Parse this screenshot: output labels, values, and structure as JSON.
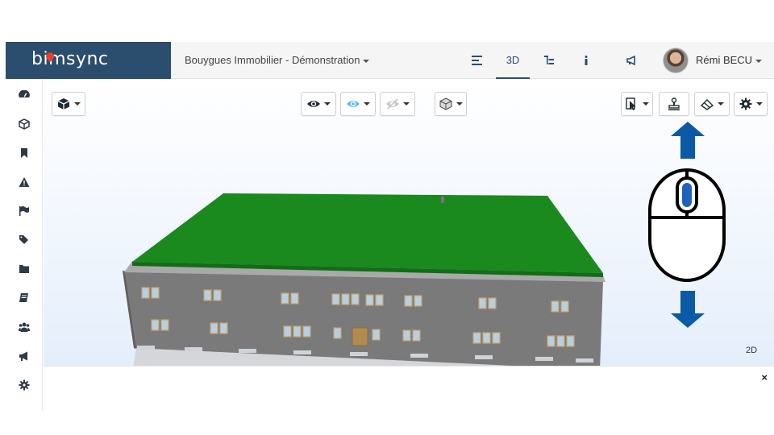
{
  "brand": {
    "logo_text": "bimsync",
    "color": "#2b4d6e",
    "accent": "#e8402f"
  },
  "header": {
    "project_name": "Bouygues Immobilier - Démonstration",
    "nav": [
      {
        "name": "list-icon",
        "label": ""
      },
      {
        "name": "3d",
        "label": "3D",
        "active": true
      },
      {
        "name": "tree-icon",
        "label": ""
      },
      {
        "name": "info-icon",
        "label": ""
      },
      {
        "name": "announce-icon",
        "label": ""
      }
    ],
    "user_name": "Rémi BECU"
  },
  "sidebar": {
    "items": [
      {
        "icon": "dashboard-icon"
      },
      {
        "icon": "cube-icon",
        "active": true
      },
      {
        "icon": "bookmark-icon"
      },
      {
        "icon": "warning-icon"
      },
      {
        "icon": "flag-icon"
      },
      {
        "icon": "tags-icon"
      },
      {
        "icon": "folder-icon"
      },
      {
        "icon": "book-icon"
      },
      {
        "icon": "users-icon"
      },
      {
        "icon": "bullhorn-icon"
      },
      {
        "icon": "gear-icon"
      }
    ]
  },
  "viewer": {
    "mode_2d_label": "2D",
    "toolbar": [
      {
        "icon": "cube-icon",
        "dropdown": true
      },
      {
        "icon": "eye-icon",
        "dropdown": true
      },
      {
        "icon": "eye-highlight-icon",
        "dropdown": true
      },
      {
        "icon": "eye-hidden-icon",
        "dropdown": true
      },
      {
        "icon": "section-box-icon",
        "dropdown": false
      },
      {
        "icon": "cursor-select-icon",
        "dropdown": true
      },
      {
        "icon": "stamp-icon",
        "dropdown": false
      },
      {
        "icon": "eraser-icon",
        "dropdown": true
      },
      {
        "icon": "gear-icon",
        "dropdown": true
      }
    ],
    "model": {
      "roof_color": "#1a8a1f",
      "wall_color": "#7a7a7a"
    },
    "annotation": {
      "icon": "mouse-scroll-icon",
      "arrow_color": "#0b5aa6"
    }
  },
  "bottom_panel": {
    "close_label": "×"
  }
}
